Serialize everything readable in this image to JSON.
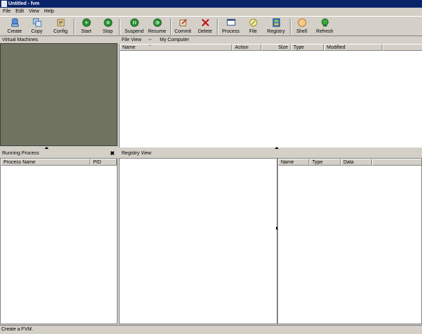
{
  "window": {
    "title": "Untitled - fvm"
  },
  "menu": [
    "File",
    "Edit",
    "View",
    "Help"
  ],
  "toolbar": {
    "create": "Create",
    "copy": "Copy",
    "config": "Config",
    "start": "Start",
    "stop": "Stop",
    "suspend": "Suspend",
    "resume": "Resume",
    "commit": "Commit",
    "delete": "Delete",
    "process": "Process",
    "file": "File",
    "registry": "Registry",
    "shell": "Shell",
    "refresh": "Refresh"
  },
  "vm_panel": {
    "title": "Virtual Machines"
  },
  "file_view": {
    "title": "File View",
    "separator": "--",
    "location": "My Computer",
    "columns": [
      "Name",
      "Action",
      "Size",
      "Type",
      "Modified"
    ]
  },
  "process_panel": {
    "title": "Running Process",
    "close_glyph": "✖",
    "columns": [
      "Process Name",
      "PID"
    ]
  },
  "registry_view": {
    "title": "Registry View",
    "columns": [
      "Name",
      "Type",
      "Data"
    ]
  },
  "status": {
    "text": "Create a FVM."
  },
  "colors": {
    "title_bar": "#0a246a",
    "vm_panel_bg": "#6f735f",
    "chrome": "#d4d0c8"
  }
}
